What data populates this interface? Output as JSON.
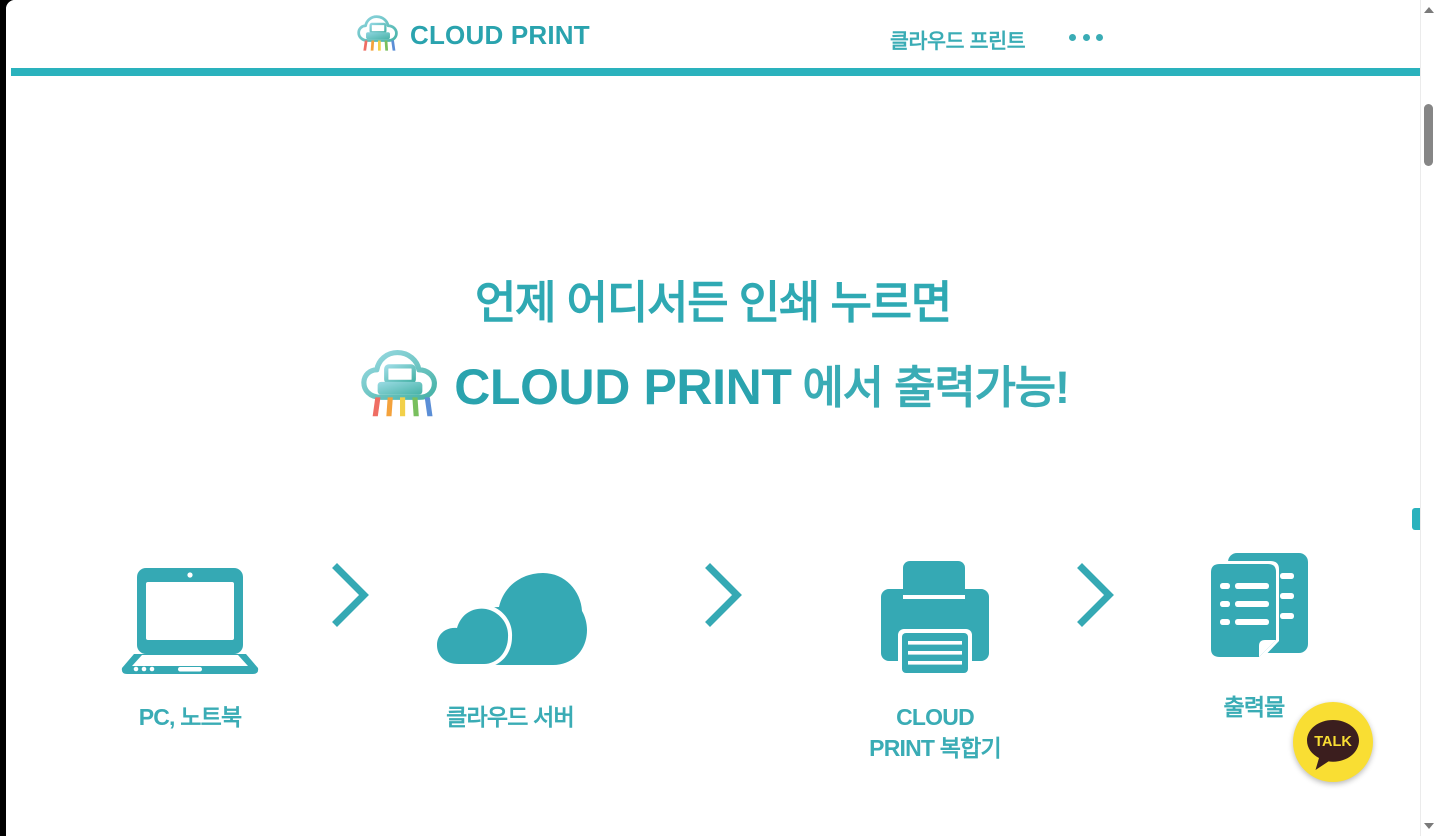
{
  "header": {
    "logo_icon": "cloud-printer-logo-icon",
    "logo_wordmark": "CLOUD PRINT",
    "nav_link": "클라우드 프린트",
    "more_menu": "···",
    "accent_color": "#2ab2bd"
  },
  "hero": {
    "headline_line1": "언제 어디서든 인쇄 누르면",
    "headline_logo_icon": "cloud-printer-logo-icon",
    "headline_brand": "CLOUD PRINT",
    "headline_line2_suffix": "에서 출력가능!",
    "text_color": "#3aacb5"
  },
  "flow": {
    "steps": [
      {
        "icon": "laptop-icon",
        "label": "PC, 노트북"
      },
      {
        "icon": "cloud-icon",
        "label": "클라우드 서버"
      },
      {
        "icon": "printer-icon",
        "label_line1": "CLOUD",
        "label_line2": "PRINT 복합기"
      },
      {
        "icon": "documents-icon",
        "label": "출력물"
      }
    ],
    "arrow_icon": "chevron-right-icon",
    "icon_color": "#35a9b4"
  },
  "floating": {
    "kakao_label": "TALK",
    "kakao_bg": "#f9de33",
    "kakao_fg": "#3b1e1e"
  },
  "scrollbar": {
    "up_arrow": "scroll-up-arrow-icon",
    "down_arrow": "scroll-down-arrow-icon",
    "thumb": "scrollbar-thumb"
  }
}
